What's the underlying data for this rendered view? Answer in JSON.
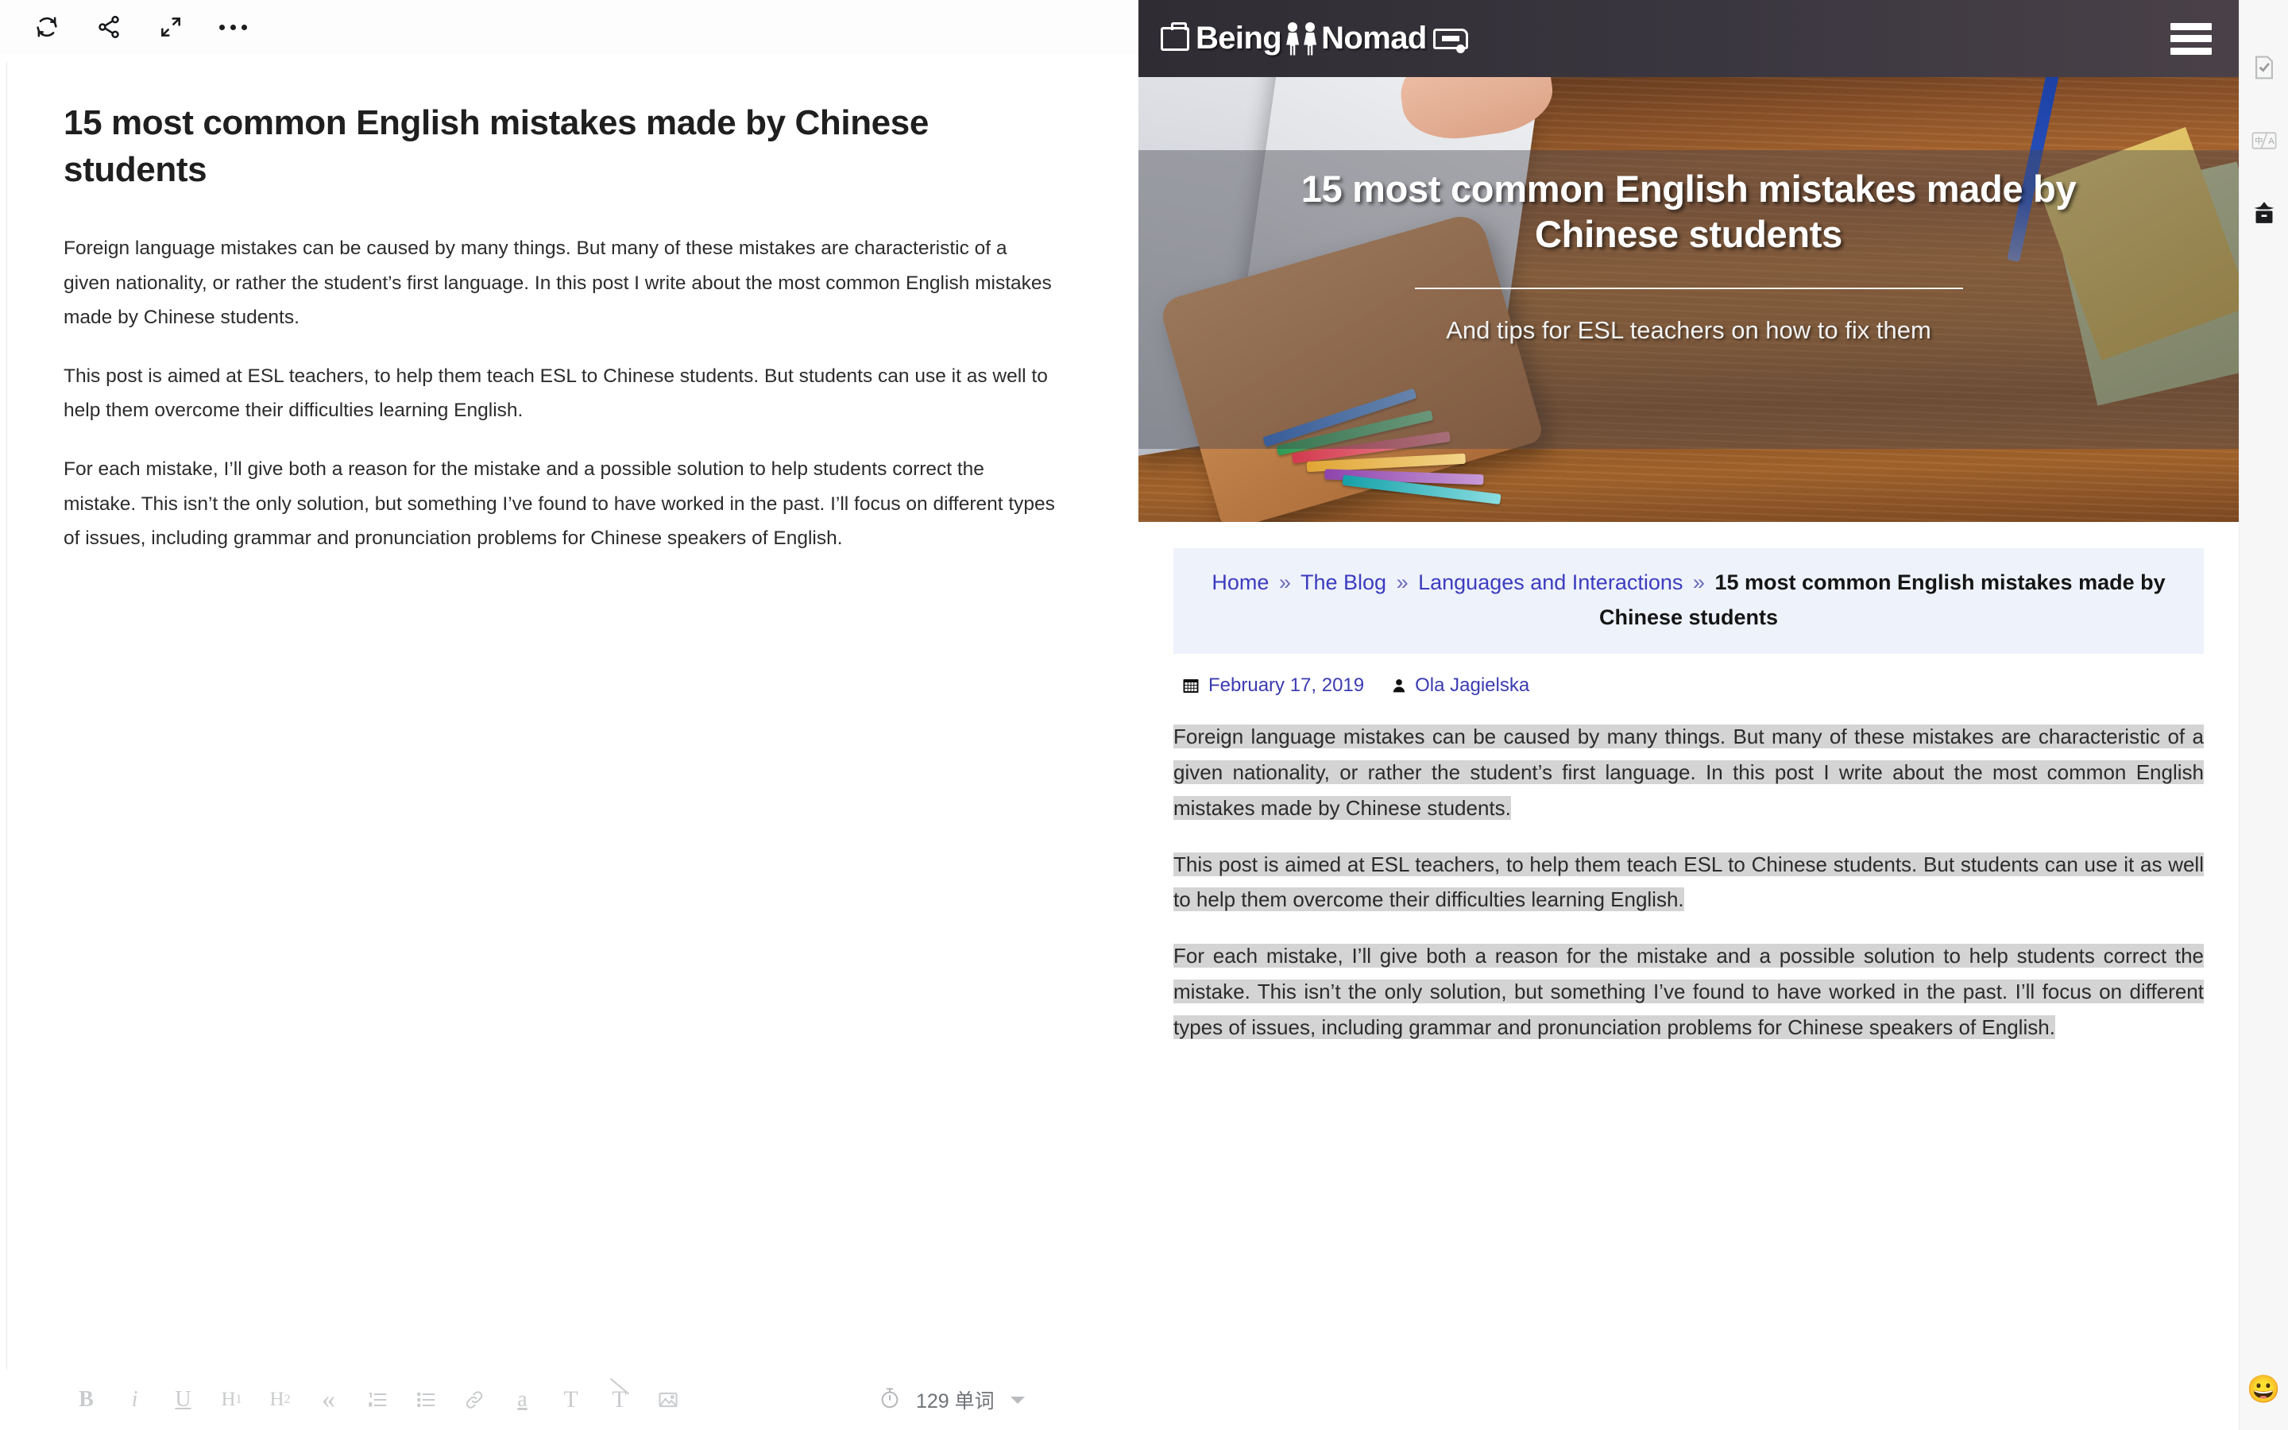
{
  "editor": {
    "toolbar_top": [
      {
        "name": "sync-icon",
        "label": "Sync"
      },
      {
        "name": "share-icon",
        "label": "Share"
      },
      {
        "name": "fullscreen-icon",
        "label": "Fullscreen"
      },
      {
        "name": "more-options-icon",
        "label": "More"
      }
    ],
    "title": "15 most common English mistakes made by Chinese students",
    "paragraphs": [
      "Foreign language mistakes can be caused by many things. But many of these mistakes are characteristic of a given nationality, or rather the student’s first language. In this post I write about the most common English mistakes made by Chinese students.",
      "This post is aimed at ESL teachers, to help them teach ESL to Chinese students. But students can use it as well to help them overcome their difficulties learning English.",
      "For each mistake, I’ll give both a reason for the mistake and a possible solution to help students correct the mistake. This isn’t the only solution, but something I’ve found to have worked in the past. I’ll focus on different types of issues, including grammar and pronunciation problems for Chinese speakers of English."
    ],
    "format_toolbar": [
      {
        "name": "bold-button",
        "label": "B"
      },
      {
        "name": "italic-button",
        "label": "i"
      },
      {
        "name": "underline-button",
        "label": "U"
      },
      {
        "name": "heading-1-button",
        "label": "H1"
      },
      {
        "name": "heading-2-button",
        "label": "H2"
      },
      {
        "name": "blockquote-button",
        "label": "“"
      },
      {
        "name": "ordered-list-button",
        "label": "1."
      },
      {
        "name": "unordered-list-button",
        "label": "•"
      },
      {
        "name": "link-button",
        "label": "link"
      },
      {
        "name": "highlight-button",
        "label": "a"
      },
      {
        "name": "text-style-button",
        "label": "T"
      },
      {
        "name": "clear-format-button",
        "label": "Tx"
      },
      {
        "name": "insert-image-button",
        "label": "image"
      }
    ],
    "word_count": "129 单词",
    "timer_icon": "stopwatch-icon"
  },
  "preview": {
    "site_logo": "Being A Nomad",
    "menu_icon": "hamburger-menu-icon",
    "hero": {
      "title": "15 most common English mistakes made by Chinese students",
      "subtitle": "And tips for ESL teachers on how to fix them"
    },
    "breadcrumb": {
      "items": [
        "Home",
        "The Blog",
        "Languages and Interactions"
      ],
      "separator": "»",
      "current": "15 most common English mistakes made by Chinese students"
    },
    "meta": {
      "date_icon": "calendar-icon",
      "date": "February 17, 2019",
      "author_icon": "user-icon",
      "author": "Ola Jagielska"
    },
    "paragraphs": [
      "Foreign language mistakes can be caused by many things. But many of these mistakes are characteristic of a given nationality, or rather the student’s first language. In this post I write about the most common English mistakes made by Chinese students.",
      "This post is aimed at ESL teachers, to help them teach ESL to Chinese students. But students can use it as well to help them overcome their difficulties learning English.",
      "For each mistake, I’ll give both a reason for the mistake and a possible solution to help students correct the mistake. This isn’t the only solution, but something I’ve found to have worked in the past. I’ll focus on different types of issues, including grammar and pronunciation problems for Chinese speakers of English."
    ]
  },
  "tool_rail": {
    "items": [
      {
        "name": "spellcheck-document-icon",
        "label": "Check"
      },
      {
        "name": "translate-icon",
        "label": "中/A"
      },
      {
        "name": "archive-box-icon",
        "label": "Archive"
      }
    ],
    "emoji_button": "😀"
  },
  "colors": {
    "header_bg": "#35323a",
    "breadcrumb_bg": "#eef2fb",
    "breadcrumb_link": "#3c3cc0",
    "selection_highlight": "#d4d4d4",
    "rail_bg": "#f7f7f7"
  }
}
